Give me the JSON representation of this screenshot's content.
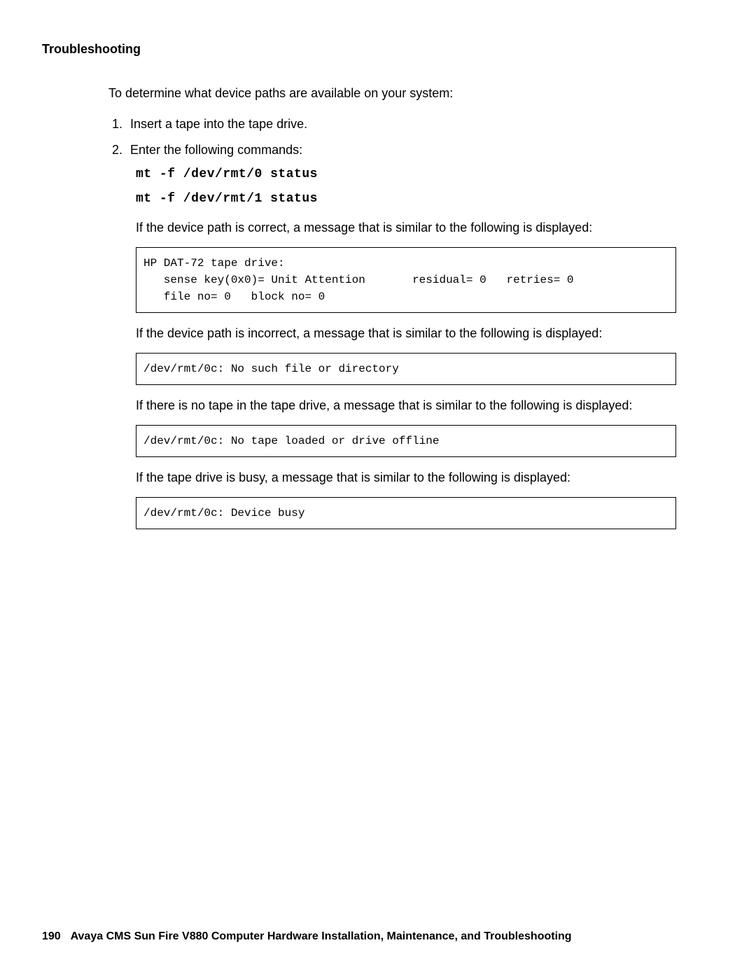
{
  "header": {
    "section": "Troubleshooting"
  },
  "content": {
    "intro": "To determine what device paths are available on your system:",
    "step1": "Insert a tape into the tape drive.",
    "step2": "Enter the following commands:",
    "cmd1": "mt -f /dev/rmt/0 status",
    "cmd2": "mt -f /dev/rmt/1 status",
    "msg_correct_intro": "If the device path is correct, a message that is similar to the following is displayed:",
    "box_correct": "HP DAT-72 tape drive:\n   sense key(0x0)= Unit Attention       residual= 0   retries= 0\n   file no= 0   block no= 0",
    "msg_incorrect_intro": "If the device path is incorrect, a message that is similar to the following is displayed:",
    "box_incorrect": "/dev/rmt/0c: No such file or directory",
    "msg_notape_intro": "If there is no tape in the tape drive, a message that is similar to the following is displayed:",
    "box_notape": "/dev/rmt/0c: No tape loaded or drive offline",
    "msg_busy_intro": "If the tape drive is busy, a message that is similar to the following is displayed:",
    "box_busy": "/dev/rmt/0c: Device busy"
  },
  "footer": {
    "page_number": "190",
    "title": "Avaya CMS Sun Fire V880 Computer Hardware Installation, Maintenance, and Troubleshooting"
  }
}
